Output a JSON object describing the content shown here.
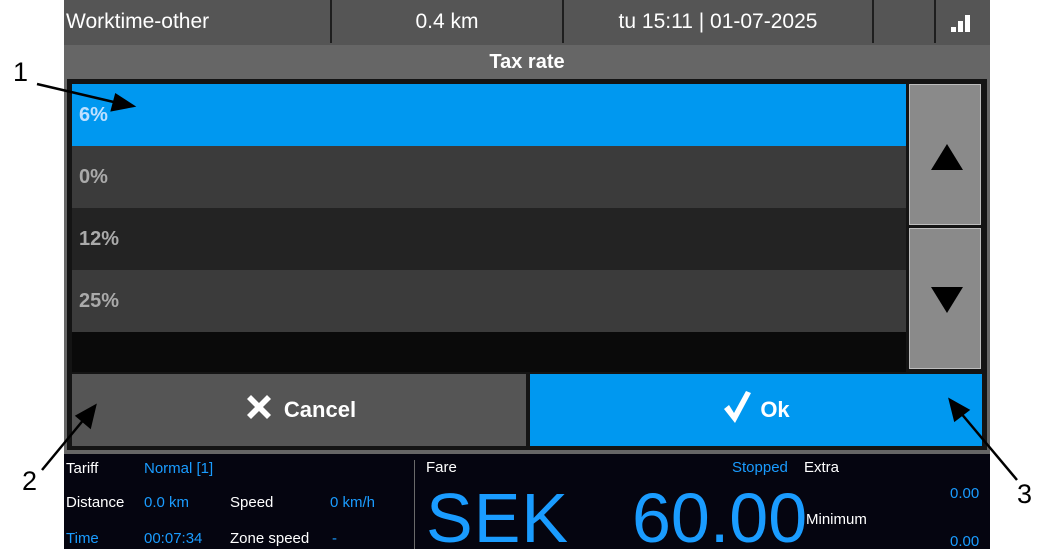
{
  "status_bar": {
    "app": "Worktime-other",
    "distance": "0.4 km",
    "datetime": "tu 15:11 | 01-07-2025",
    "signal_icon": "signal-bars-icon"
  },
  "dialog": {
    "title": "Tax rate",
    "options": [
      {
        "label": "6%",
        "selected": true
      },
      {
        "label": "0%",
        "selected": false
      },
      {
        "label": "12%",
        "selected": false
      },
      {
        "label": "25%",
        "selected": false
      }
    ],
    "scroll_up_icon": "triangle-up-icon",
    "scroll_down_icon": "triangle-down-icon",
    "cancel_label": "Cancel",
    "cancel_icon": "x-icon",
    "ok_label": "Ok",
    "ok_icon": "checkmark-icon"
  },
  "meter": {
    "tariff_label": "Tariff",
    "tariff_value": "Normal [1]",
    "distance_label": "Distance",
    "distance_value": "0.0 km",
    "speed_label": "Speed",
    "speed_value": "0 km/h",
    "time_label": "Time",
    "time_value": "00:07:34",
    "zone_speed_label": "Zone speed",
    "zone_speed_value": "-",
    "fare_label": "Fare",
    "fare_status": "Stopped",
    "fare_currency": "SEK",
    "fare_amount": "60.00",
    "extra_label": "Extra",
    "extra_value": "0.00",
    "minimum_label": "Minimum",
    "minimum_value": "0.00"
  },
  "callouts": [
    "1",
    "2",
    "3"
  ],
  "colors": {
    "accent": "#0098f0",
    "meter_blue": "#1a9cff",
    "background": "#666666"
  }
}
